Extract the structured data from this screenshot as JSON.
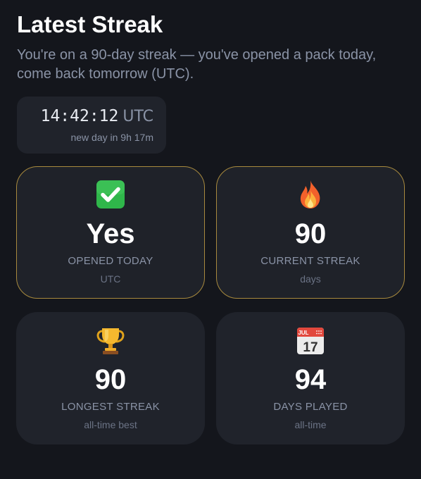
{
  "header": {
    "title": "Latest Streak",
    "subtitle": "You're on a 90-day streak — you've opened a pack today, come back tomorrow (UTC)."
  },
  "clock": {
    "time": "14:42:12",
    "timezone": "UTC",
    "next_day": "new day in 9h 17m"
  },
  "cards": [
    {
      "icon": "check-mark-icon",
      "value": "Yes",
      "label": "OPENED TODAY",
      "sub": "UTC"
    },
    {
      "icon": "fire-icon",
      "value": "90",
      "label": "CURRENT STREAK",
      "sub": "days"
    },
    {
      "icon": "trophy-icon",
      "value": "90",
      "label": "LONGEST STREAK",
      "sub": "all-time best"
    },
    {
      "icon": "calendar-icon",
      "value": "94",
      "label": "DAYS PLAYED",
      "sub": "all-time",
      "calendar_month": "JUL",
      "calendar_day": "17"
    }
  ],
  "colors": {
    "background": "#14161c",
    "card": "#20232b",
    "highlight_border": "#a88a3e",
    "muted_text": "#8a93a6"
  }
}
